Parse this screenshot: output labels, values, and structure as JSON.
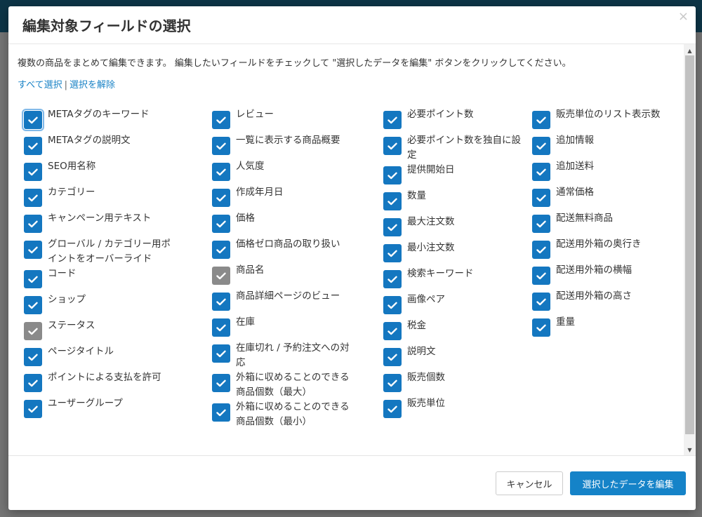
{
  "modal": {
    "title": "編集対象フィールドの選択",
    "close_glyph": "×",
    "intro": "複数の商品をまとめて編集できます。 編集したいフィールドをチェックして \"選択したデータを編集\" ボタンをクリックしてください。",
    "select_all": "すべて選択",
    "separator": "|",
    "deselect": "選択を解除",
    "columns": [
      {
        "items": [
          {
            "label": "METAタグのキーワード",
            "checked": true
          },
          {
            "label": "METAタグの説明文",
            "checked": true
          },
          {
            "label": "SEO用名称",
            "checked": true
          },
          {
            "label": "カテゴリー",
            "checked": true
          },
          {
            "label": "キャンペーン用テキスト",
            "checked": true
          },
          {
            "label": "グローバル / カテゴリー用ポイントをオーバーライド",
            "checked": true
          },
          {
            "label": "コード",
            "checked": true
          },
          {
            "label": "ショップ",
            "checked": true
          },
          {
            "label": "ステータス",
            "checked": true,
            "disabled": true
          },
          {
            "label": "ページタイトル",
            "checked": true
          },
          {
            "label": "ポイントによる支払を許可",
            "checked": true
          },
          {
            "label": "ユーザーグループ",
            "checked": true
          }
        ]
      },
      {
        "items": [
          {
            "label": "レビュー",
            "checked": true
          },
          {
            "label": "一覧に表示する商品概要",
            "checked": true
          },
          {
            "label": "人気度",
            "checked": true
          },
          {
            "label": "作成年月日",
            "checked": true
          },
          {
            "label": "価格",
            "checked": true
          },
          {
            "label": "価格ゼロ商品の取り扱い",
            "checked": true
          },
          {
            "label": "商品名",
            "checked": true,
            "disabled": true
          },
          {
            "label": "商品詳細ページのビュー",
            "checked": true
          },
          {
            "label": "在庫",
            "checked": true
          },
          {
            "label": "在庫切れ / 予約注文への対応",
            "checked": true
          },
          {
            "label": "外箱に収めることのできる商品個数（最大）",
            "checked": true
          },
          {
            "label": "外箱に収めることのできる商品個数（最小）",
            "checked": true
          }
        ]
      },
      {
        "items": [
          {
            "label": "必要ポイント数",
            "checked": true
          },
          {
            "label": "必要ポイント数を独自に設定",
            "checked": true
          },
          {
            "label": "提供開始日",
            "checked": true
          },
          {
            "label": "数量",
            "checked": true
          },
          {
            "label": "最大注文数",
            "checked": true
          },
          {
            "label": "最小注文数",
            "checked": true
          },
          {
            "label": "検索キーワード",
            "checked": true
          },
          {
            "label": "画像ペア",
            "checked": true
          },
          {
            "label": "税金",
            "checked": true
          },
          {
            "label": "説明文",
            "checked": true
          },
          {
            "label": "販売個数",
            "checked": true
          },
          {
            "label": "販売単位",
            "checked": true
          }
        ]
      },
      {
        "items": [
          {
            "label": "販売単位のリスト表示数",
            "checked": true
          },
          {
            "label": "追加情報",
            "checked": true
          },
          {
            "label": "追加送料",
            "checked": true
          },
          {
            "label": "通常価格",
            "checked": true
          },
          {
            "label": "配送無料商品",
            "checked": true
          },
          {
            "label": "配送用外箱の奥行き",
            "checked": true
          },
          {
            "label": "配送用外箱の横幅",
            "checked": true
          },
          {
            "label": "配送用外箱の高さ",
            "checked": true
          },
          {
            "label": "重量",
            "checked": true
          }
        ]
      }
    ],
    "cancel_label": "キャンセル",
    "edit_label": "選択したデータを編集"
  },
  "scrollbar": {
    "up": "▲",
    "down": "▼"
  },
  "colors": {
    "checkbox_checked": "#1477c0",
    "checkbox_disabled": "#8a8a8a",
    "primary_button": "#1583c8",
    "link": "#1a83c6"
  }
}
